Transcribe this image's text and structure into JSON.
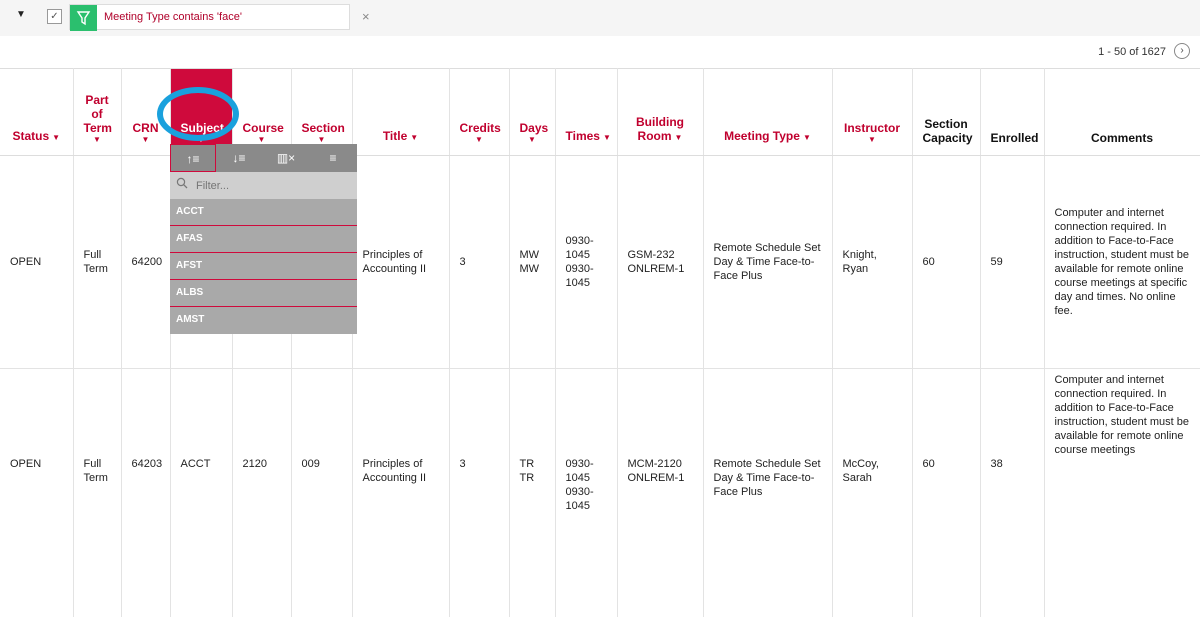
{
  "filter_bar": {
    "filter_text": "Meeting Type contains 'face'",
    "close_glyph": "×",
    "collapse_glyph": "▼",
    "check_glyph": "✓"
  },
  "pager": {
    "text": "1 - 50 of 1627",
    "next_glyph": "›"
  },
  "columns": [
    {
      "label": "Status"
    },
    {
      "label": "Part of Term"
    },
    {
      "label": "CRN"
    },
    {
      "label": "Subject"
    },
    {
      "label": "Course"
    },
    {
      "label": "Section"
    },
    {
      "label": "Title"
    },
    {
      "label": "Credits"
    },
    {
      "label": "Days"
    },
    {
      "label": "Times"
    },
    {
      "label": "Building Room"
    },
    {
      "label": "Meeting Type"
    },
    {
      "label": "Instructor"
    },
    {
      "label": "Section Capacity"
    },
    {
      "label": "Enrolled"
    },
    {
      "label": "Comments"
    }
  ],
  "rows": [
    {
      "status": "OPEN",
      "part_of_term": "Full Term",
      "crn": "64200",
      "subject": "",
      "course": "",
      "section": "",
      "title": "Principles of Accounting II",
      "credits": "3",
      "days": "MW\nMW",
      "times": "0930-1045\n0930-1045",
      "building_room": "GSM-232\nONLREM-1",
      "meeting_type": "Remote Schedule Set Day & Time Face-to-Face Plus",
      "instructor": "Knight, Ryan",
      "capacity": "60",
      "enrolled": "59",
      "comments": "Computer and internet connection required. In addition to Face-to-Face instruction, student must be available for remote online course meetings at specific day and times. No online fee."
    },
    {
      "status": "OPEN",
      "part_of_term": "Full Term",
      "crn": "64203",
      "subject": "ACCT",
      "course": "2120",
      "section": "009",
      "title": "Principles of Accounting II",
      "credits": "3",
      "days": "TR\nTR",
      "times": "0930-1045\n0930-1045",
      "building_room": "MCM-2120\nONLREM-1",
      "meeting_type": "Remote Schedule Set Day & Time Face-to-Face Plus",
      "instructor": "McCoy, Sarah",
      "capacity": "60",
      "enrolled": "38",
      "comments": "Computer and internet connection required. In addition to Face-to-Face instruction, student must be available for remote online course meetings"
    }
  ],
  "dropdown": {
    "toolbar_glyphs": [
      "↑≡",
      "↓≡",
      "▥×",
      "≡"
    ],
    "filter_placeholder": "Filter...",
    "items": [
      "ACCT",
      "AFAS",
      "AFST",
      "ALBS",
      "AMST"
    ]
  },
  "colors": {
    "accent": "#cf0a3c",
    "filter_green": "#2bbf6e",
    "highlight_circle": "#1aa1dd"
  }
}
